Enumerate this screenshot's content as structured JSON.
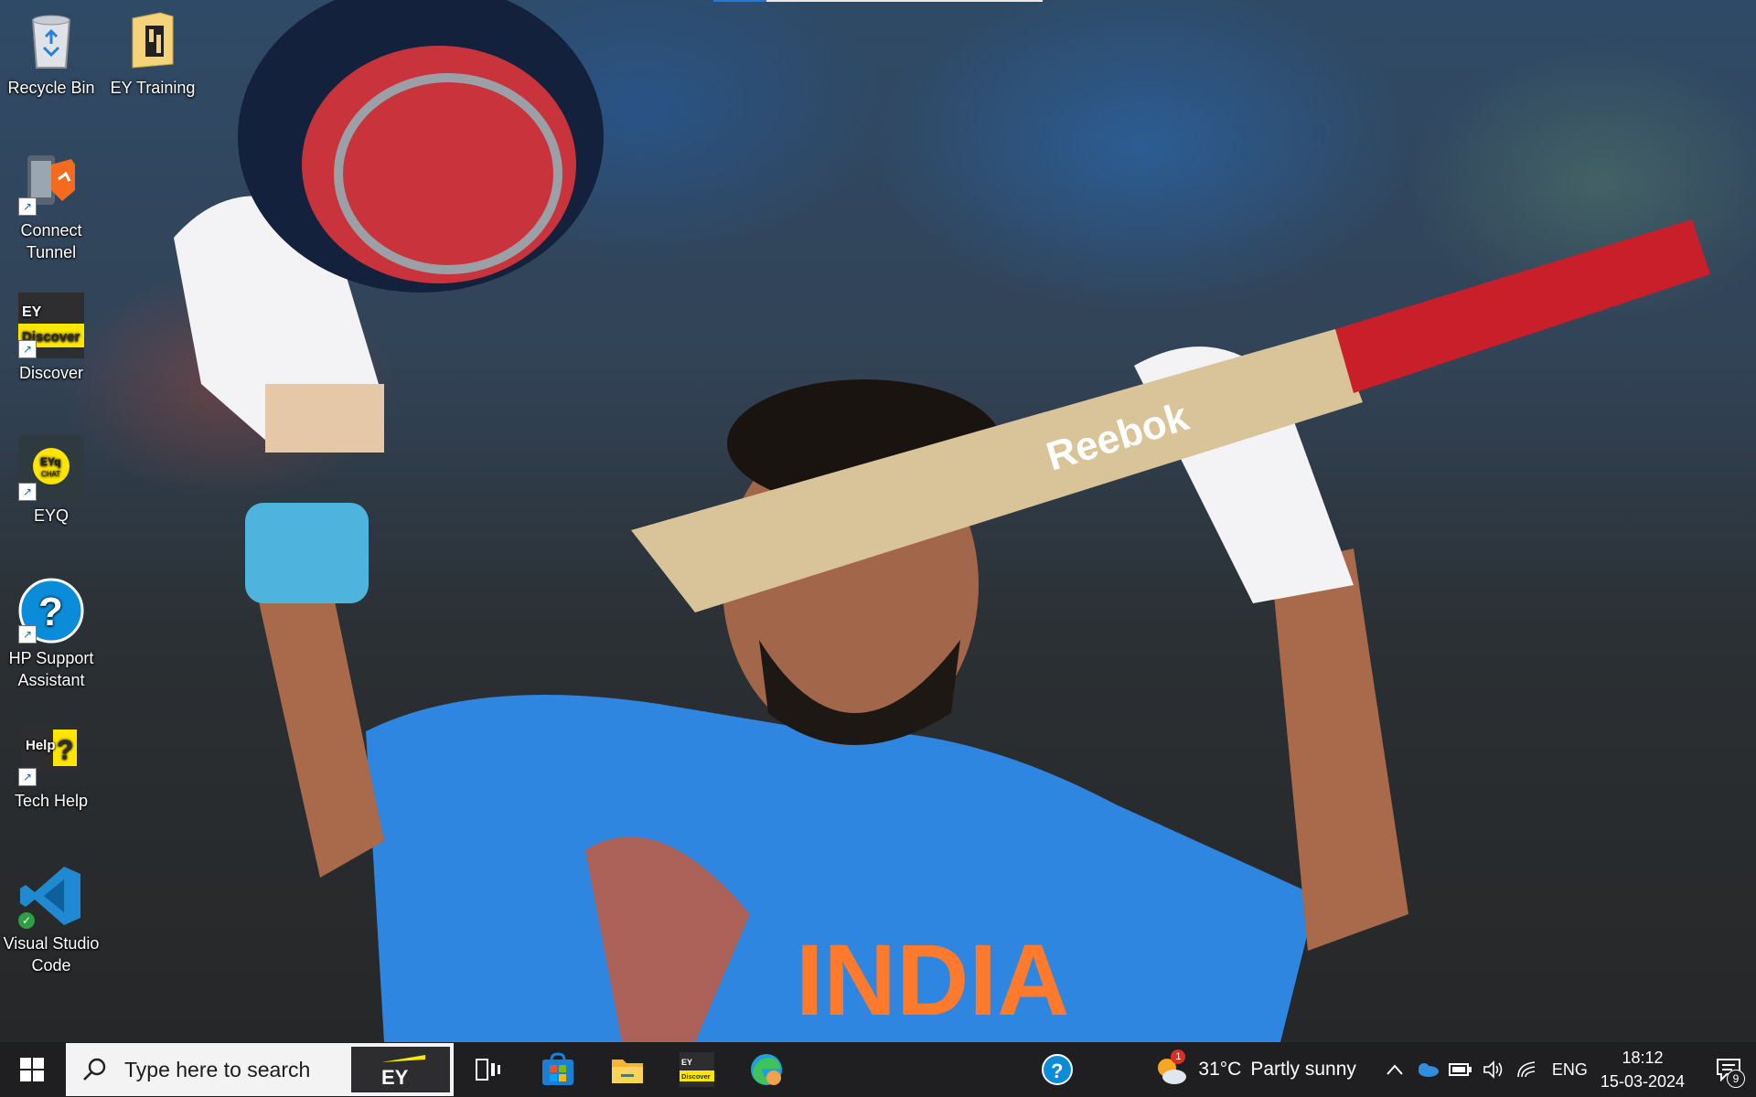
{
  "top_progress": {
    "fraction": 0.16
  },
  "desktop_icons": [
    {
      "label": "Recycle Bin",
      "icon": "recycle-bin-icon"
    },
    {
      "label": "EY Training",
      "icon": "folder-icon"
    },
    {
      "label": "Connect Tunnel",
      "icon": "connect-tunnel-icon"
    },
    {
      "label": "Discover",
      "icon": "ey-discover-icon"
    },
    {
      "label": "EYQ",
      "icon": "eyq-chat-icon"
    },
    {
      "label": "HP Support Assistant",
      "icon": "hp-support-icon"
    },
    {
      "label": "Tech Help",
      "icon": "tech-help-icon"
    },
    {
      "label": "Visual Studio Code",
      "icon": "vscode-icon"
    }
  ],
  "wallpaper": {
    "jersey_text": "INDIA",
    "bat_brand": "Reebok"
  },
  "taskbar": {
    "search_placeholder": "Type here to search",
    "search_logo": "EY",
    "pinned_apps": [
      {
        "name": "Task View",
        "icon": "task-view-icon"
      },
      {
        "name": "Microsoft Store",
        "icon": "store-icon"
      },
      {
        "name": "File Explorer",
        "icon": "folder-icon"
      },
      {
        "name": "EY Discover",
        "icon": "ey-discover-icon"
      },
      {
        "name": "Microsoft Edge",
        "icon": "edge-icon"
      },
      {
        "name": "Help",
        "icon": "help-icon"
      }
    ],
    "weather": {
      "temp": "31°C",
      "condition": "Partly sunny",
      "badge": "1"
    },
    "tray": {
      "language": "ENG",
      "time": "18:12",
      "date": "15-03-2024",
      "notification_count": "9"
    }
  },
  "colors": {
    "taskbar": "#1f1f21",
    "accent": "#2a74d6",
    "jersey": "#2f86e0"
  }
}
